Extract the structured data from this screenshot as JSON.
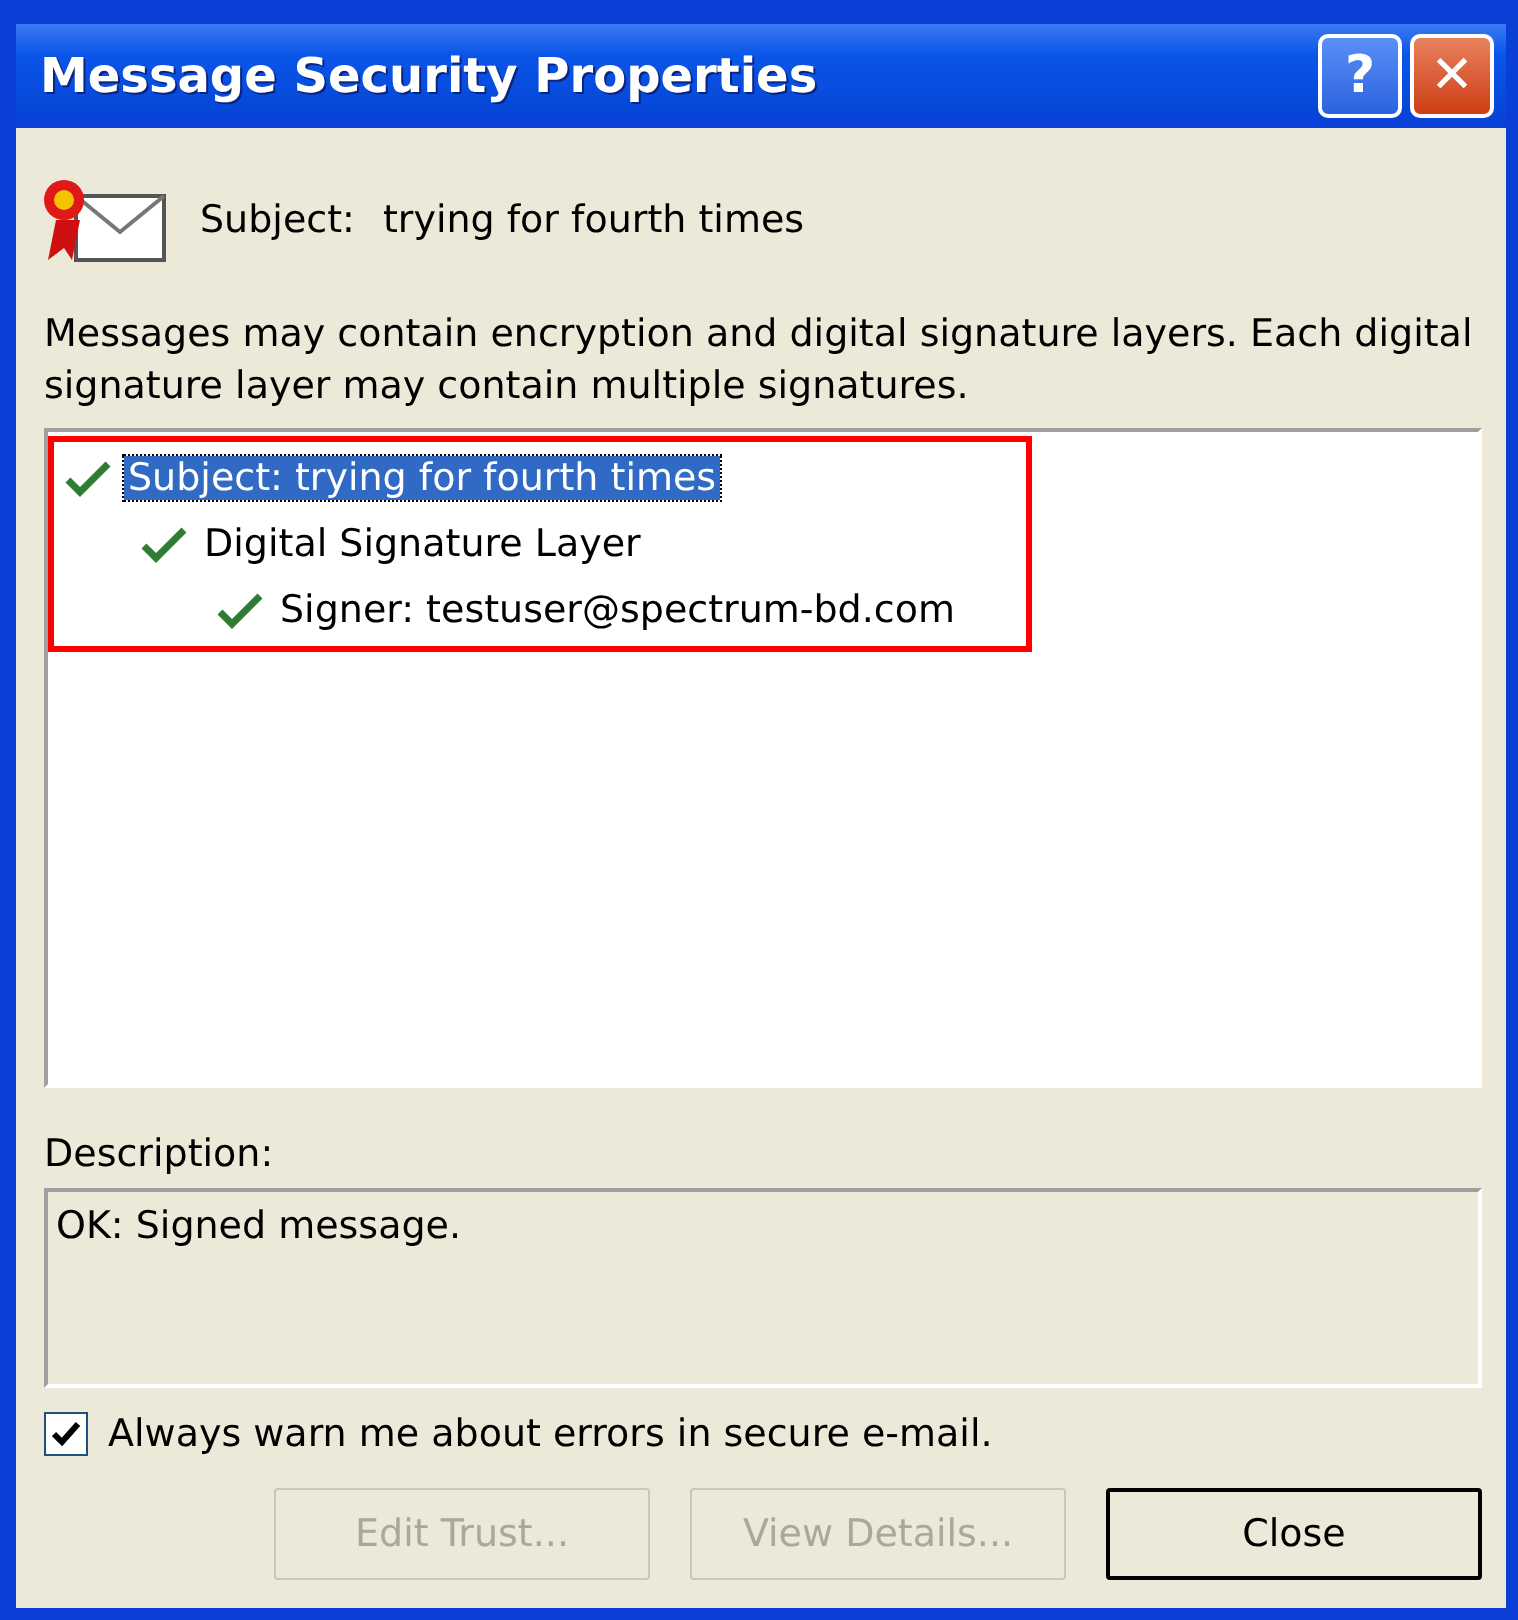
{
  "window": {
    "title": "Message Security Properties",
    "buttons": [
      {
        "kind": "help",
        "label": "?"
      },
      {
        "kind": "close",
        "label": "✕"
      }
    ]
  },
  "subject": {
    "label": "Subject:",
    "value": "trying for fourth times"
  },
  "intro": "Messages may contain encryption and digital signature layers.  Each digital signature layer may contain multiple signatures.",
  "tree": {
    "highlighted": true,
    "items": [
      {
        "label": "Subject: trying for fourth times",
        "selected": true,
        "valid": true,
        "children": [
          {
            "label": "Digital Signature Layer",
            "selected": false,
            "valid": true,
            "children": [
              {
                "label": "Signer: testuser@spectrum-bd.com",
                "selected": false,
                "valid": true
              }
            ]
          }
        ]
      }
    ]
  },
  "description": {
    "label": "Description:",
    "text": "OK: Signed message."
  },
  "warn_checkbox": {
    "label": "Always warn me about errors in secure e-mail.",
    "checked": true
  },
  "buttons": [
    {
      "label": "Edit Trust...",
      "disabled": true,
      "default": false
    },
    {
      "label": "View Details...",
      "disabled": true,
      "default": false
    },
    {
      "label": "Close",
      "disabled": false,
      "default": true
    }
  ]
}
